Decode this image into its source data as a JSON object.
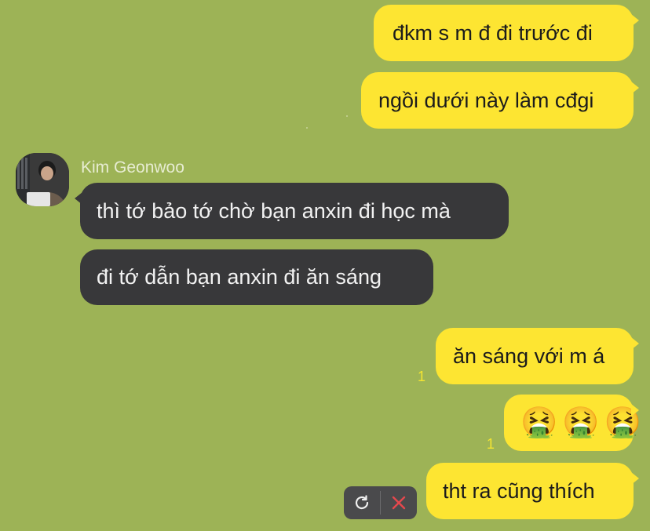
{
  "messages": [
    {
      "text": "đkm s m đ đi trước đi",
      "from": "me"
    },
    {
      "text": "ngồi dưới này làm cđgi",
      "from": "me"
    },
    {
      "sender": "Kim Geonwoo",
      "text": "thì tớ bảo tớ chờ bạn anxin đi học mà",
      "from": "them"
    },
    {
      "text": "đi tớ dẫn bạn anxin đi ăn sáng",
      "from": "them"
    },
    {
      "text": "ăn sáng với m á",
      "from": "me",
      "unread": "1"
    },
    {
      "emoji": [
        "🤮",
        "🤮",
        "🤮"
      ],
      "from": "me",
      "unread": "1"
    },
    {
      "text": "tht ra cũng thích",
      "from": "me",
      "failed": true
    }
  ],
  "failed_actions": {
    "retry_icon": "retry-icon",
    "delete_icon": "close-icon"
  },
  "colors": {
    "background": "#9db356",
    "my_bubble": "#fde532",
    "their_bubble": "#38383a",
    "unread": "#f5e531",
    "delete_x": "#e5484d"
  }
}
